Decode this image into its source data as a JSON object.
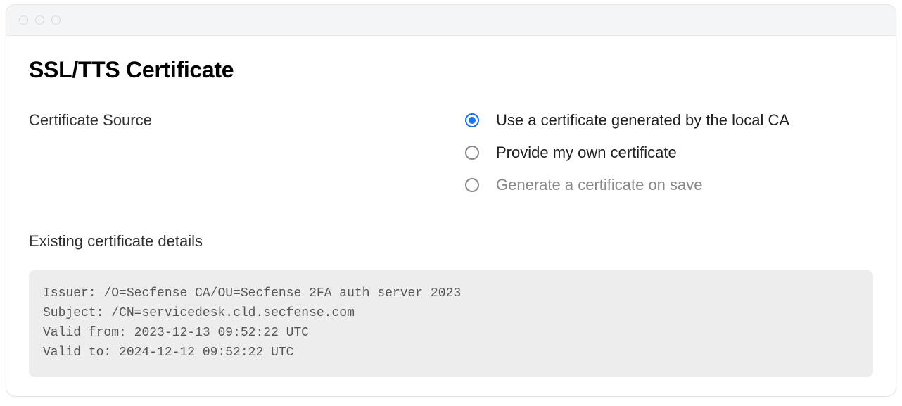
{
  "page": {
    "title": "SSL/TTS Certificate"
  },
  "source": {
    "label": "Certificate Source",
    "options": [
      {
        "label": "Use a certificate generated by the local CA",
        "selected": true,
        "disabled": false
      },
      {
        "label": "Provide my own certificate",
        "selected": false,
        "disabled": false
      },
      {
        "label": "Generate a certificate on save",
        "selected": false,
        "disabled": true
      }
    ]
  },
  "details": {
    "title": "Existing certificate details",
    "issuer_label": "Issuer:",
    "issuer_value": "/O=Secfense CA/OU=Secfense 2FA auth server 2023",
    "subject_label": "Subject:",
    "subject_value": "/CN=servicedesk.cld.secfense.com",
    "valid_from_label": "Valid from:",
    "valid_from_value": "2023-12-13 09:52:22 UTC",
    "valid_to_label": "Valid to:",
    "valid_to_value": "2024-12-12 09:52:22 UTC"
  }
}
